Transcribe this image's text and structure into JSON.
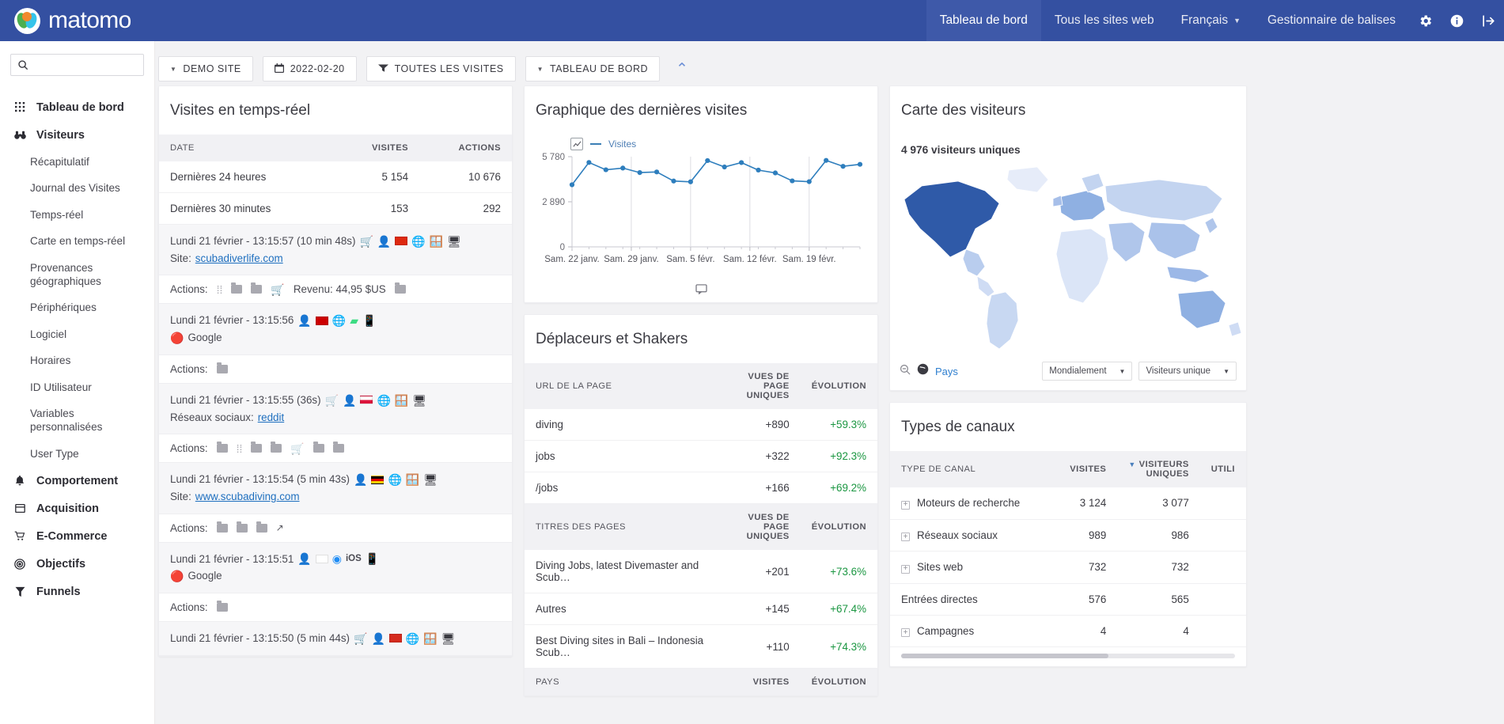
{
  "header": {
    "brand": "matomo",
    "nav": [
      {
        "label": "Tableau de bord",
        "active": true
      },
      {
        "label": "Tous les sites web",
        "active": false
      },
      {
        "label": "Français",
        "active": false,
        "caret": true
      },
      {
        "label": "Gestionnaire de balises",
        "active": false
      }
    ],
    "icons": [
      "gear-icon",
      "info-icon",
      "signout-icon"
    ]
  },
  "sidebar": {
    "search_placeholder": "",
    "items": [
      {
        "label": "Tableau de bord",
        "level": "top",
        "icon": "grid-icon"
      },
      {
        "label": "Visiteurs",
        "level": "top",
        "icon": "binoculars-icon"
      },
      {
        "label": "Récapitulatif",
        "level": "sub"
      },
      {
        "label": "Journal des Visites",
        "level": "sub"
      },
      {
        "label": "Temps-réel",
        "level": "sub"
      },
      {
        "label": "Carte en temps-réel",
        "level": "sub"
      },
      {
        "label": "Provenances géographiques",
        "level": "sub"
      },
      {
        "label": "Périphériques",
        "level": "sub"
      },
      {
        "label": "Logiciel",
        "level": "sub"
      },
      {
        "label": "Horaires",
        "level": "sub"
      },
      {
        "label": "ID Utilisateur",
        "level": "sub"
      },
      {
        "label": "Variables personnalisées",
        "level": "sub"
      },
      {
        "label": "User Type",
        "level": "sub"
      },
      {
        "label": "Comportement",
        "level": "top",
        "icon": "bell-icon"
      },
      {
        "label": "Acquisition",
        "level": "top",
        "icon": "window-icon"
      },
      {
        "label": "E-Commerce",
        "level": "top",
        "icon": "cart-icon"
      },
      {
        "label": "Objectifs",
        "level": "top",
        "icon": "target-icon"
      },
      {
        "label": "Funnels",
        "level": "top",
        "icon": "funnel-icon"
      }
    ]
  },
  "toolbar": {
    "site": "DEMO SITE",
    "date": "2022-02-20",
    "segment": "TOUTES LES VISITES",
    "dashboard": "TABLEAU DE BORD"
  },
  "realtime": {
    "title": "Visites en temps-réel",
    "columns": [
      "DATE",
      "VISITES",
      "ACTIONS"
    ],
    "summary": [
      {
        "label": "Dernières 24 heures",
        "visits": "5 154",
        "actions": "10 676"
      },
      {
        "label": "Dernières 30 minutes",
        "visits": "153",
        "actions": "292"
      }
    ],
    "visits": [
      {
        "time": "Lundi 21 février - 13:15:57 (10 min 48s)",
        "icons": [
          "cart-icon",
          "visitor-icon",
          "flag-cn",
          "chrome-icon",
          "windows-icon",
          "desktop-icon"
        ],
        "ref_label": "Site:",
        "ref_value": "scubadiverlife.com",
        "actions_label": "Actions:",
        "actions_extra": "Revenu: 44,95 $US",
        "action_icons": 6
      },
      {
        "time": "Lundi 21 février - 13:15:56",
        "icons": [
          "visitor-icon",
          "flag-my",
          "chrome-icon",
          "android-icon",
          "mobile-icon"
        ],
        "ref_label": "",
        "ref_value": "Google",
        "actions_label": "Actions:",
        "actions_extra": "",
        "action_icons": 1
      },
      {
        "time": "Lundi 21 février - 13:15:55 (36s)",
        "icons": [
          "cart-abandoned-icon",
          "visitor-icon",
          "flag-pl",
          "chrome-icon",
          "windows-icon",
          "desktop-icon"
        ],
        "ref_label": "Réseaux sociaux:",
        "ref_value": "reddit",
        "actions_label": "Actions:",
        "actions_extra": "",
        "action_icons": 7
      },
      {
        "time": "Lundi 21 février - 13:15:54 (5 min 43s)",
        "icons": [
          "visitor-icon",
          "flag-de",
          "chrome-icon",
          "windows-icon",
          "desktop-icon"
        ],
        "ref_label": "Site:",
        "ref_value": "www.scubadiving.com",
        "actions_label": "Actions:",
        "actions_extra": "",
        "action_icons": 4
      },
      {
        "time": "Lundi 21 février - 13:15:51",
        "icons": [
          "visitor-icon",
          "flag-kr",
          "safari-icon",
          "ios-icon",
          "mobile-icon"
        ],
        "ref_label": "",
        "ref_value": "Google",
        "actions_label": "Actions:",
        "actions_extra": "",
        "action_icons": 1
      },
      {
        "time": "Lundi 21 février - 13:15:50 (5 min 44s)",
        "icons": [
          "cart-icon",
          "visitor-icon",
          "flag-ch",
          "chrome-icon",
          "windows-icon",
          "desktop-icon"
        ],
        "ref_label": "",
        "ref_value": "",
        "actions_label": "",
        "actions_extra": "",
        "action_icons": 0
      }
    ]
  },
  "visits_graph": {
    "title": "Graphique des dernières visites",
    "legend": "Visites"
  },
  "chart_data": {
    "type": "line",
    "title": "Graphique des dernières visites",
    "xlabel": "",
    "ylabel": "",
    "ylim": [
      0,
      5780
    ],
    "ytick_labels": [
      "5 780",
      "2 890",
      "0"
    ],
    "yticks": [
      5780,
      2890,
      0
    ],
    "grid": true,
    "legend_position": "top-left",
    "xtick_labels": [
      "Sam. 22 janv.",
      "Sam. 29 janv.",
      "Sam. 5 févr.",
      "Sam. 12 févr.",
      "Sam. 19 févr."
    ],
    "series": [
      {
        "name": "Visites",
        "color": "#2e7ebd",
        "values": [
          3980,
          5410,
          4940,
          5050,
          4760,
          4800,
          4220,
          4170,
          5530,
          5120,
          5400,
          4920,
          4740,
          4230,
          4180,
          5540,
          5160,
          5290
        ]
      }
    ]
  },
  "movers": {
    "title": "Déplaceurs et Shakers",
    "pages_header": [
      "URL DE LA PAGE",
      "VUES DE PAGE UNIQUES",
      "ÉVOLUTION"
    ],
    "pages": [
      {
        "label": "diving",
        "views": "+890",
        "evolution": "+59.3%"
      },
      {
        "label": "jobs",
        "views": "+322",
        "evolution": "+92.3%"
      },
      {
        "label": "/jobs",
        "views": "+166",
        "evolution": "+69.2%"
      }
    ],
    "titles_header": [
      "TITRES DES PAGES",
      "VUES DE PAGE UNIQUES",
      "ÉVOLUTION"
    ],
    "titles": [
      {
        "label": "Diving Jobs, latest Divemaster and Scub…",
        "views": "+201",
        "evolution": "+73.6%"
      },
      {
        "label": "Autres",
        "views": "+145",
        "evolution": "+67.4%"
      },
      {
        "label": "Best Diving sites in Bali – Indonesia Scub…",
        "views": "+110",
        "evolution": "+74.3%"
      }
    ],
    "country_header": [
      "PAYS",
      "VISITES",
      "ÉVOLUTION"
    ]
  },
  "visitor_map": {
    "title": "Carte des visiteurs",
    "subtitle": "4 976 visiteurs uniques",
    "footer_link": "Pays",
    "scope_select": "Mondialement",
    "metric_select": "Visiteurs unique"
  },
  "channels": {
    "title": "Types de canaux",
    "columns": [
      "TYPE DE CANAL",
      "VISITES",
      "VISITEURS UNIQUES",
      "UTILI"
    ],
    "rows": [
      {
        "label": "Moteurs de recherche",
        "visits": "3 124",
        "unique": "3 077",
        "expandable": true
      },
      {
        "label": "Réseaux sociaux",
        "visits": "989",
        "unique": "986",
        "expandable": true
      },
      {
        "label": "Sites web",
        "visits": "732",
        "unique": "732",
        "expandable": true
      },
      {
        "label": "Entrées directes",
        "visits": "576",
        "unique": "565",
        "expandable": false
      },
      {
        "label": "Campagnes",
        "visits": "4",
        "unique": "4",
        "expandable": true
      }
    ]
  },
  "colors": {
    "brand": "#3450a1",
    "accent": "#2e7ebd",
    "positive": "#1a9641"
  }
}
